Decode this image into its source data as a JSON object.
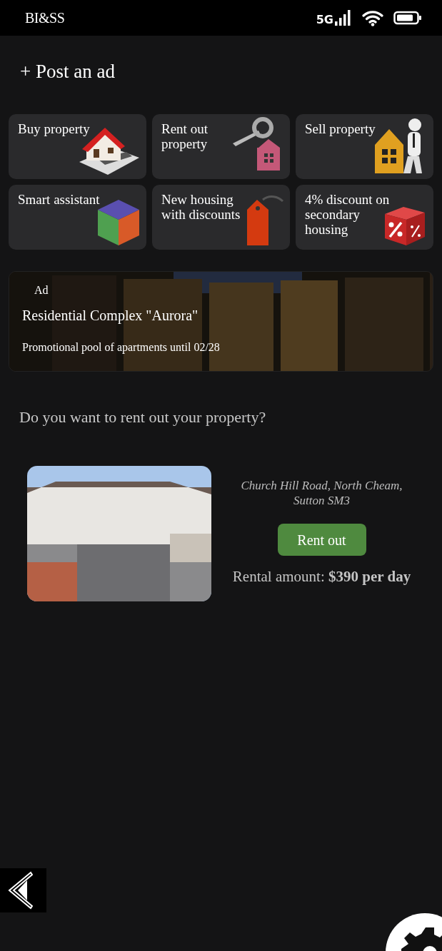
{
  "status_bar": {
    "brand": "BI&SS",
    "network": "5G"
  },
  "post_ad": {
    "label": "+ Post an ad"
  },
  "tiles": [
    {
      "label": "Buy property",
      "kind": "house"
    },
    {
      "label": "Rent out property",
      "kind": "key"
    },
    {
      "label": "Sell property",
      "kind": "agent"
    },
    {
      "label": "Smart assistant",
      "kind": "cube"
    },
    {
      "label": "New housing with discounts",
      "kind": "tag"
    },
    {
      "label": "4% discount on secondary housing",
      "kind": "dice"
    }
  ],
  "banner": {
    "badge": "Ad",
    "title": "Residential Complex \"Aurora\"",
    "subtitle": "Promotional pool of apartments until 02/28"
  },
  "question": "Do you want to rent out your property?",
  "listing": {
    "address": "Church Hill Road, North Cheam, Sutton SM3",
    "button": "Rent out",
    "amount": "Rental amount: **$390 per day**"
  }
}
